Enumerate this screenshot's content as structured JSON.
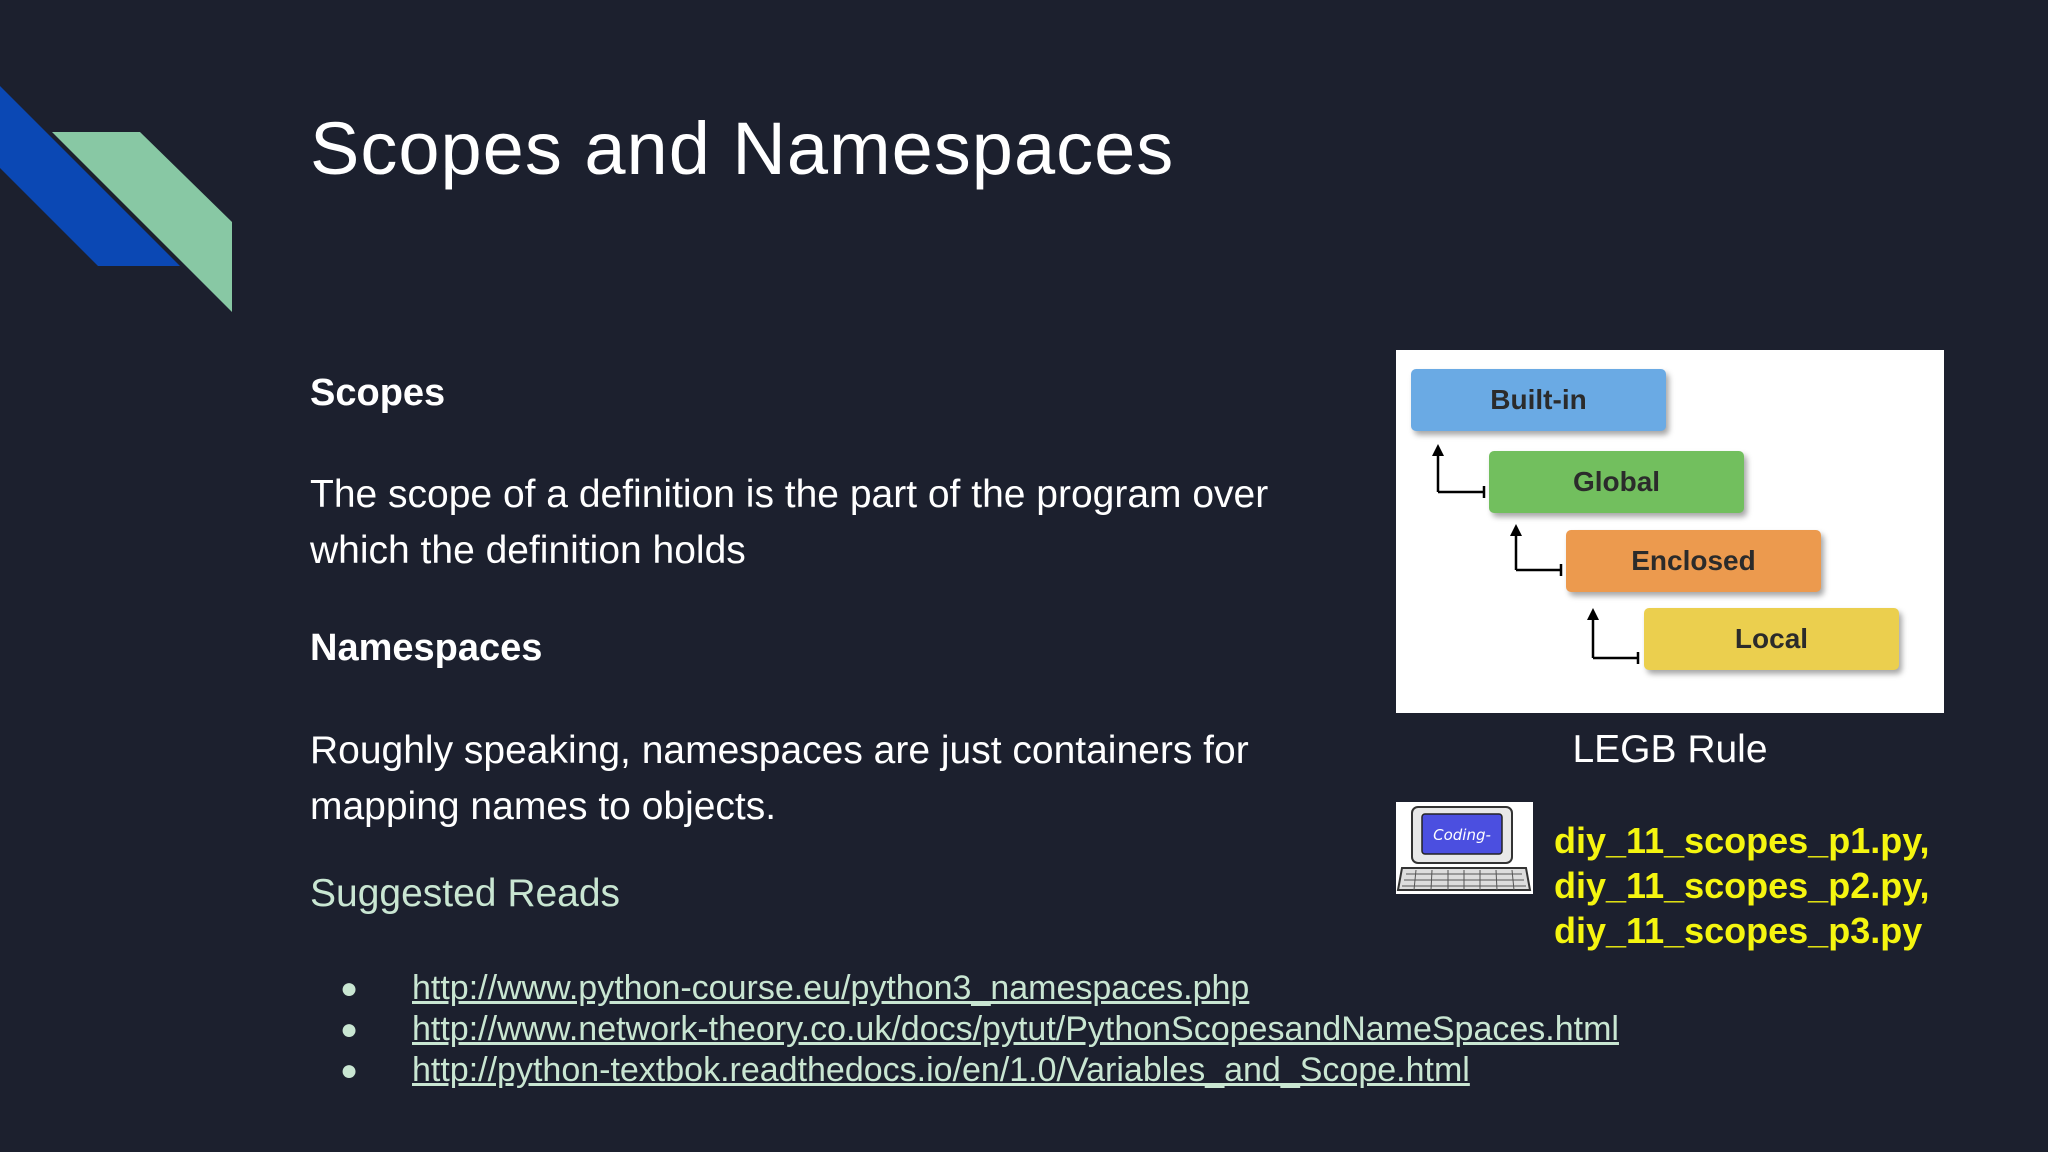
{
  "slide": {
    "title": "Scopes and Namespaces",
    "scopes_heading": "Scopes",
    "scopes_text_line1": "The scope of a definition is the part of the program over",
    "scopes_text_line2": "which the definition holds",
    "namespaces_heading": "Namespaces",
    "namespaces_text_line1": "Roughly speaking, namespaces are just containers for",
    "namespaces_text_line2": "mapping names to objects.",
    "suggested_reads": "Suggested Reads",
    "links": [
      "http://www.python-course.eu/python3_namespaces.php",
      "http://www.network-theory.co.uk/docs/pytut/PythonScopesandNameSpaces.html",
      "http://python-textbok.readthedocs.io/en/1.0/Variables_and_Scope.html"
    ],
    "bullet": "●"
  },
  "legb": {
    "steps": [
      "Built-in",
      "Global",
      "Enclosed",
      "Local"
    ],
    "caption": "LEGB Rule",
    "colors": [
      "#6aaae4",
      "#72bf5e",
      "#ec9a4e",
      "#ebcf4e"
    ]
  },
  "coding_image": {
    "screen_text": "Coding-"
  },
  "files": [
    "diy_11_scopes_p1.py,",
    "diy_11_scopes_p2.py,",
    "diy_11_scopes_p3.py"
  ],
  "colors": {
    "background": "#1c202e",
    "accent_blue": "#0b48b4",
    "accent_green": "#88c8a4",
    "link": "#c9e6d2",
    "file_yellow": "#f5f510"
  }
}
